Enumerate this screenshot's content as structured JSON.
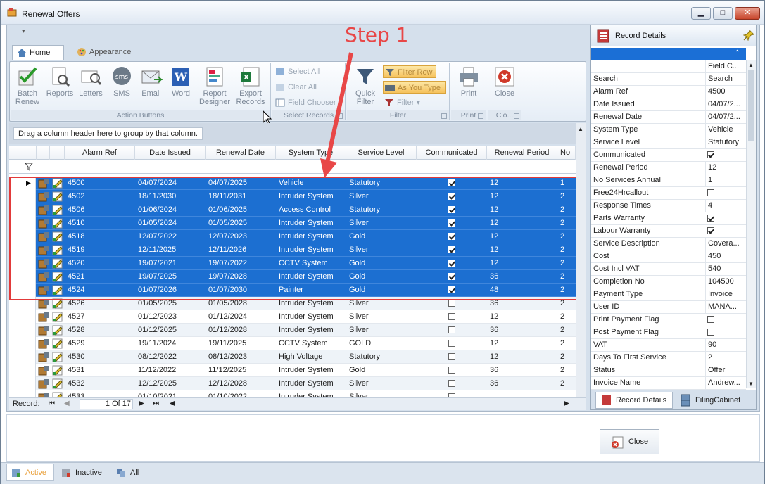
{
  "window": {
    "title": "Renewal Offers",
    "min": "▁",
    "max": "□",
    "close": "✕"
  },
  "qat": "▾",
  "tabs": [
    {
      "label": "Home"
    },
    {
      "label": "Appearance"
    }
  ],
  "ribbon": {
    "action": {
      "label": "Action Buttons",
      "buttons": [
        "Batch Renew",
        "Reports",
        "Letters",
        "SMS",
        "Email",
        "Word",
        "Report Designer",
        "Export Records"
      ]
    },
    "select": {
      "label": "Select Records",
      "items": [
        "Select All",
        "Clear All",
        "Field Chooser"
      ]
    },
    "filter": {
      "label": "Filter",
      "quick": "Quick Filter",
      "filter_row": "Filter Row",
      "as_you_type": "As You Type",
      "filter": "Filter"
    },
    "print": {
      "label": "Print",
      "button": "Print"
    },
    "close": {
      "label": "Clo...",
      "button": "Close"
    }
  },
  "groupbar": "Drag a column header here to group by that column.",
  "columns": [
    "Alarm Ref",
    "Date Issued",
    "Renewal Date",
    "System Type",
    "Service Level",
    "Communicated",
    "Renewal Period",
    "No S"
  ],
  "rows": [
    {
      "ref": "4500",
      "issued": "04/07/2024",
      "renewal": "04/07/2025",
      "system": "Vehicle",
      "level": "Statutory",
      "comm": true,
      "period": "12",
      "nos": "1",
      "sel": true
    },
    {
      "ref": "4502",
      "issued": "18/11/2030",
      "renewal": "18/11/2031",
      "system": "Intruder System",
      "level": "Silver",
      "comm": true,
      "period": "12",
      "nos": "2",
      "sel": true
    },
    {
      "ref": "4506",
      "issued": "01/06/2024",
      "renewal": "01/06/2025",
      "system": "Access Control",
      "level": "Statutory",
      "comm": true,
      "period": "12",
      "nos": "2",
      "sel": true
    },
    {
      "ref": "4510",
      "issued": "01/05/2024",
      "renewal": "01/05/2025",
      "system": "Intruder System",
      "level": "Silver",
      "comm": true,
      "period": "12",
      "nos": "2",
      "sel": true
    },
    {
      "ref": "4518",
      "issued": "12/07/2022",
      "renewal": "12/07/2023",
      "system": "Intruder System",
      "level": "Gold",
      "comm": true,
      "period": "12",
      "nos": "2",
      "sel": true
    },
    {
      "ref": "4519",
      "issued": "12/11/2025",
      "renewal": "12/11/2026",
      "system": "Intruder System",
      "level": "Silver",
      "comm": true,
      "period": "12",
      "nos": "2",
      "sel": true
    },
    {
      "ref": "4520",
      "issued": "19/07/2021",
      "renewal": "19/07/2022",
      "system": "CCTV System",
      "level": "Gold",
      "comm": true,
      "period": "12",
      "nos": "2",
      "sel": true
    },
    {
      "ref": "4521",
      "issued": "19/07/2025",
      "renewal": "19/07/2028",
      "system": "Intruder System",
      "level": "Gold",
      "comm": true,
      "period": "36",
      "nos": "2",
      "sel": true
    },
    {
      "ref": "4524",
      "issued": "01/07/2026",
      "renewal": "01/07/2030",
      "system": "Painter",
      "level": "Gold",
      "comm": true,
      "period": "48",
      "nos": "2",
      "sel": true
    },
    {
      "ref": "4526",
      "issued": "01/05/2025",
      "renewal": "01/05/2028",
      "system": "Intruder System",
      "level": "Silver",
      "comm": false,
      "period": "36",
      "nos": "2",
      "sel": false
    },
    {
      "ref": "4527",
      "issued": "01/12/2023",
      "renewal": "01/12/2024",
      "system": "Intruder System",
      "level": "Silver",
      "comm": false,
      "period": "12",
      "nos": "2",
      "sel": false
    },
    {
      "ref": "4528",
      "issued": "01/12/2025",
      "renewal": "01/12/2028",
      "system": "Intruder System",
      "level": "Silver",
      "comm": false,
      "period": "36",
      "nos": "2",
      "sel": false
    },
    {
      "ref": "4529",
      "issued": "19/11/2024",
      "renewal": "19/11/2025",
      "system": "CCTV System",
      "level": "GOLD",
      "comm": false,
      "period": "12",
      "nos": "2",
      "sel": false
    },
    {
      "ref": "4530",
      "issued": "08/12/2022",
      "renewal": "08/12/2023",
      "system": "High Voltage",
      "level": "Statutory",
      "comm": false,
      "period": "12",
      "nos": "2",
      "sel": false
    },
    {
      "ref": "4531",
      "issued": "11/12/2022",
      "renewal": "11/12/2025",
      "system": "Intruder System",
      "level": "Gold",
      "comm": false,
      "period": "36",
      "nos": "2",
      "sel": false
    },
    {
      "ref": "4532",
      "issued": "12/12/2025",
      "renewal": "12/12/2028",
      "system": "Intruder System",
      "level": "Silver",
      "comm": false,
      "period": "36",
      "nos": "2",
      "sel": false
    },
    {
      "ref": "4533",
      "issued": "01/10/2021",
      "renewal": "01/10/2022",
      "system": "Intruder System",
      "level": "Silver",
      "comm": false,
      "period": "",
      "nos": "",
      "sel": false
    }
  ],
  "nav": {
    "label": "Record:",
    "page": "1",
    "of": "Of",
    "total": "17"
  },
  "record_panel": {
    "title": "Record Details",
    "field_col": "Field C...",
    "props": [
      {
        "k": "Search",
        "v": "Search"
      },
      {
        "k": "Alarm Ref",
        "v": "4500"
      },
      {
        "k": "Date Issued",
        "v": "04/07/2..."
      },
      {
        "k": "Renewal Date",
        "v": "04/07/2..."
      },
      {
        "k": "System Type",
        "v": "Vehicle"
      },
      {
        "k": "Service Level",
        "v": "Statutory"
      },
      {
        "k": "Communicated",
        "cb": true
      },
      {
        "k": "Renewal Period",
        "v": "12"
      },
      {
        "k": "No Services Annual",
        "v": "1"
      },
      {
        "k": "Free24Hrcallout",
        "cb": false
      },
      {
        "k": "Response Times",
        "v": "4"
      },
      {
        "k": "Parts Warranty",
        "cb": true
      },
      {
        "k": "Labour Warranty",
        "cb": true
      },
      {
        "k": "Service Description",
        "v": "Covera..."
      },
      {
        "k": "Cost",
        "v": "450"
      },
      {
        "k": "Cost Incl VAT",
        "v": "540"
      },
      {
        "k": "Completion No",
        "v": "104500"
      },
      {
        "k": "Payment Type",
        "v": "Invoice"
      },
      {
        "k": "User ID",
        "v": "MANA..."
      },
      {
        "k": "Print Payment Flag",
        "cb": false
      },
      {
        "k": "Post Payment Flag",
        "cb": false
      },
      {
        "k": "VAT",
        "v": "90"
      },
      {
        "k": "Days To First Service",
        "v": "2"
      },
      {
        "k": "Status",
        "v": "Offer"
      },
      {
        "k": "Invoice Name",
        "v": "Andrew..."
      }
    ],
    "tabs": [
      "Record Details",
      "FilingCabinet"
    ]
  },
  "close_button": "Close",
  "bottom_tabs": [
    "Active",
    "Inactive",
    "All"
  ],
  "annotation": "Step 1",
  "colors": {
    "selection": "#1c6fd1",
    "annotation": "#e84747"
  }
}
